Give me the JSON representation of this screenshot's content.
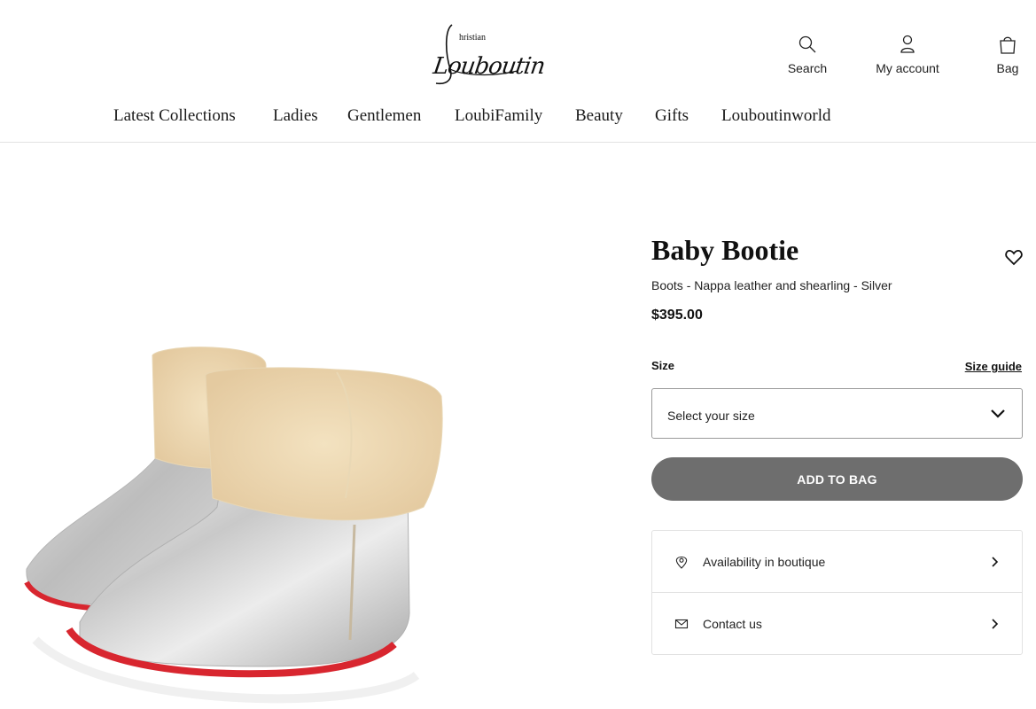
{
  "header": {
    "logo_small": "hristian",
    "logo_big": "Louboutin",
    "utilities": {
      "search": {
        "label": "Search",
        "icon": "search-icon"
      },
      "account": {
        "label": "My account",
        "icon": "user-icon"
      },
      "bag": {
        "label": "Bag",
        "icon": "bag-icon"
      }
    },
    "nav": [
      {
        "label": "Latest Collections"
      },
      {
        "label": "Ladies"
      },
      {
        "label": "Gentlemen"
      },
      {
        "label": "LoubiFamily"
      },
      {
        "label": "Beauty"
      },
      {
        "label": "Gifts"
      },
      {
        "label": "Louboutinworld"
      }
    ]
  },
  "product": {
    "title": "Baby Bootie",
    "subtitle": "Boots - Nappa leather and shearling - Silver",
    "price": "$395.00",
    "size_label": "Size",
    "size_guide": "Size guide",
    "size_placeholder": "Select your size",
    "add_to_bag": "ADD TO BAG",
    "wishlist_icon": "heart-icon",
    "image_icon": "baby-bootie-image"
  },
  "services": [
    {
      "label": "Availability in boutique",
      "icon": "location-pin-icon"
    },
    {
      "label": "Contact us",
      "icon": "envelope-icon"
    }
  ],
  "colors": {
    "button_bg": "#6e6e6e",
    "button_text": "#ffffff",
    "sole_red": "#d8262f",
    "text": "#111111"
  }
}
